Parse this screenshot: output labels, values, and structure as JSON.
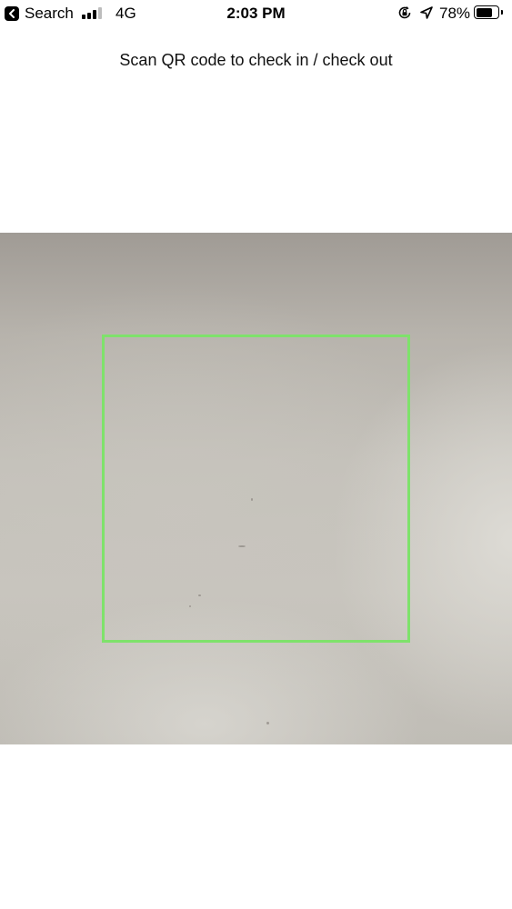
{
  "status_bar": {
    "back_label": "Search",
    "network": "4G",
    "time": "2:03 PM",
    "battery_percent": "78%",
    "battery_level": 0.78,
    "signal_bars_active": 3,
    "signal_bars_total": 4,
    "icons": {
      "back": "back-arrow-icon",
      "signal": "signal-bars-icon",
      "orientation_lock": "orientation-lock-icon",
      "location": "location-arrow-icon",
      "battery": "battery-icon"
    }
  },
  "scanner": {
    "instruction": "Scan QR code to check in / check out",
    "frame_color": "#7ee26b"
  }
}
